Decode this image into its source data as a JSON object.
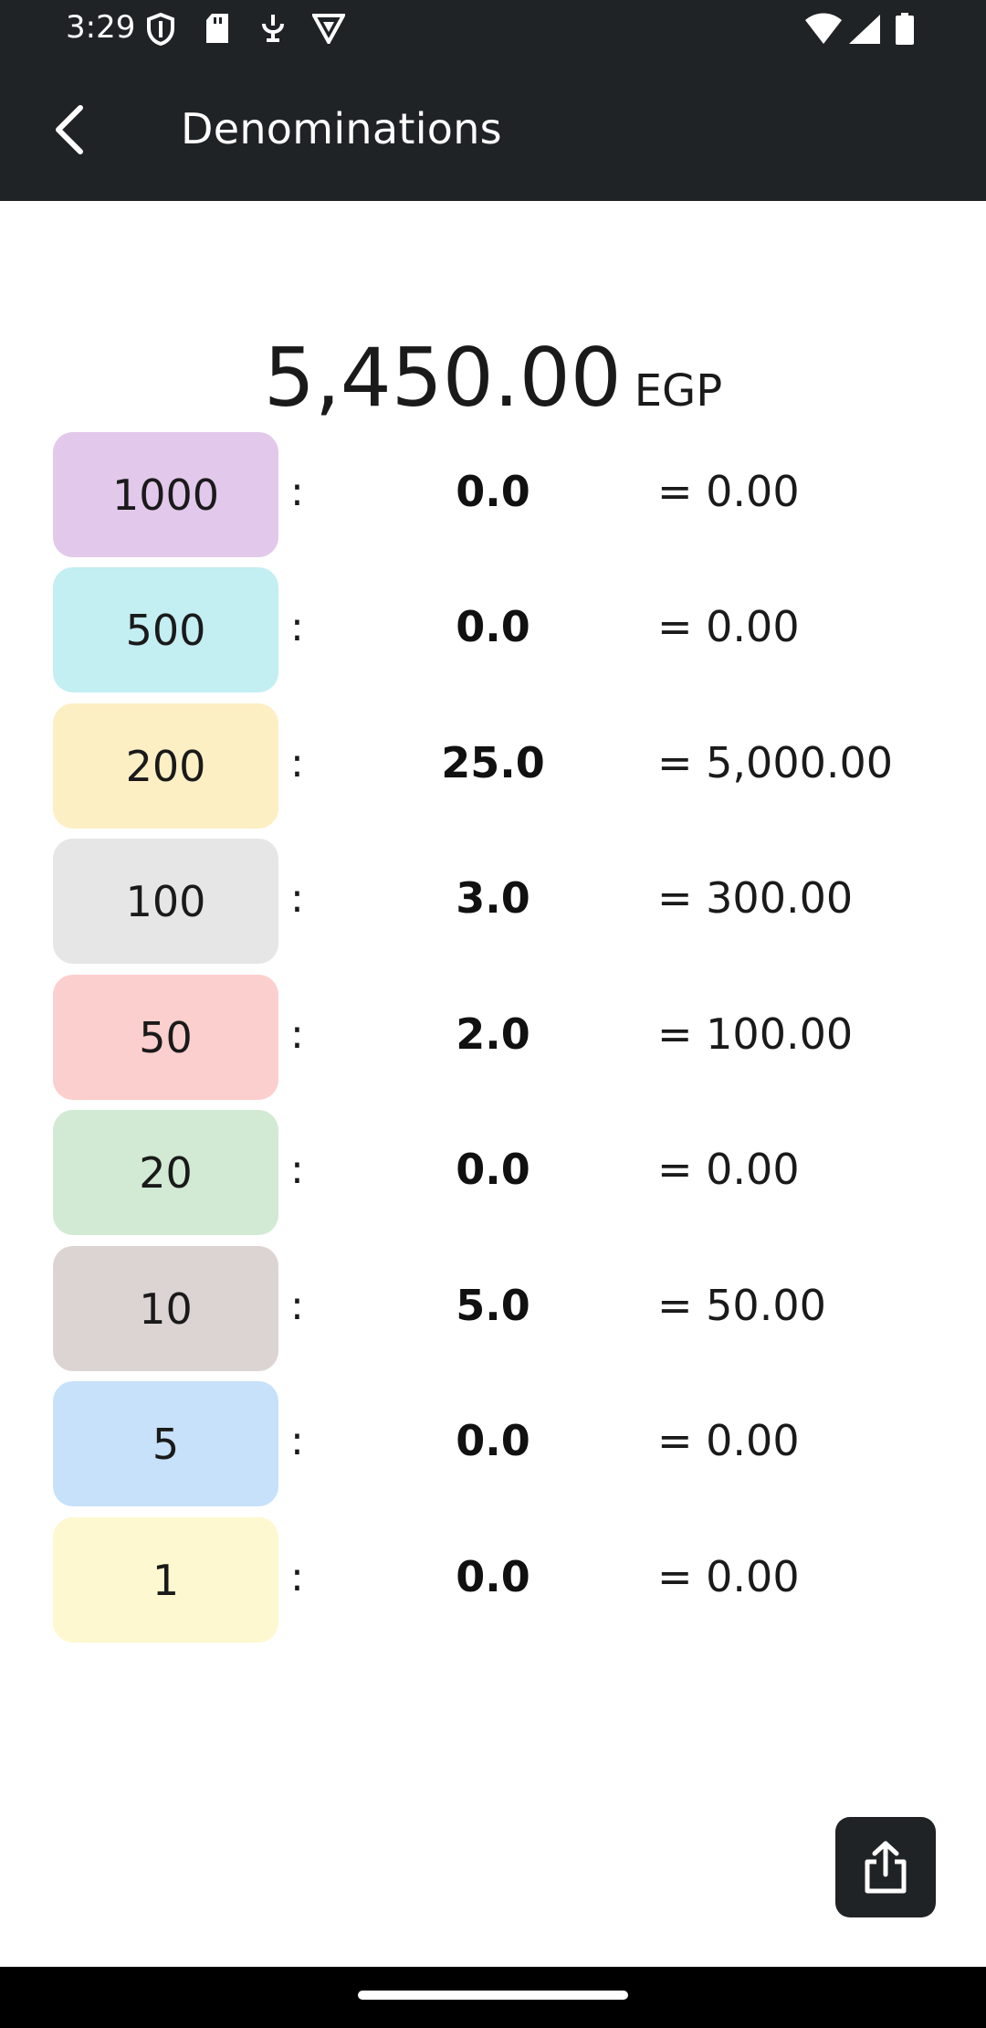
{
  "status_bar": {
    "time": "3:29",
    "left_icons": [
      "shield-icon",
      "sd-card-icon",
      "usb-debug-icon",
      "vpn-icon"
    ],
    "right_icons": [
      "wifi-icon",
      "signal-icon",
      "battery-icon"
    ]
  },
  "app_bar": {
    "title": "Denominations",
    "back_icon": "chevron-left-icon"
  },
  "total": {
    "amount": "5,450.00",
    "currency": "EGP"
  },
  "denominations": [
    {
      "label": "1000",
      "separator": ":",
      "count": "0.0",
      "subtotal": "= 0.00",
      "color": "#e2c8ea"
    },
    {
      "label": "500",
      "separator": ":",
      "count": "0.0",
      "subtotal": "= 0.00",
      "color": "#c3eef2"
    },
    {
      "label": "200",
      "separator": ":",
      "count": "25.0",
      "subtotal": "= 5,000.00",
      "color": "#fdefc4"
    },
    {
      "label": "100",
      "separator": ":",
      "count": "3.0",
      "subtotal": "= 300.00",
      "color": "#e6e6e6"
    },
    {
      "label": "50",
      "separator": ":",
      "count": "2.0",
      "subtotal": "= 100.00",
      "color": "#fbcfcd"
    },
    {
      "label": "20",
      "separator": ":",
      "count": "0.0",
      "subtotal": "= 0.00",
      "color": "#d2ead4"
    },
    {
      "label": "10",
      "separator": ":",
      "count": "5.0",
      "subtotal": "= 50.00",
      "color": "#dcd4d2"
    },
    {
      "label": "5",
      "separator": ":",
      "count": "0.0",
      "subtotal": "= 0.00",
      "color": "#c6e1f9"
    },
    {
      "label": "1",
      "separator": ":",
      "count": "0.0",
      "subtotal": "= 0.00",
      "color": "#fdf8cf"
    }
  ],
  "share": {
    "icon": "share-icon"
  },
  "colors": {
    "app_bar": "#1f2326",
    "background": "#ffffff",
    "nav_bar": "#000000"
  }
}
